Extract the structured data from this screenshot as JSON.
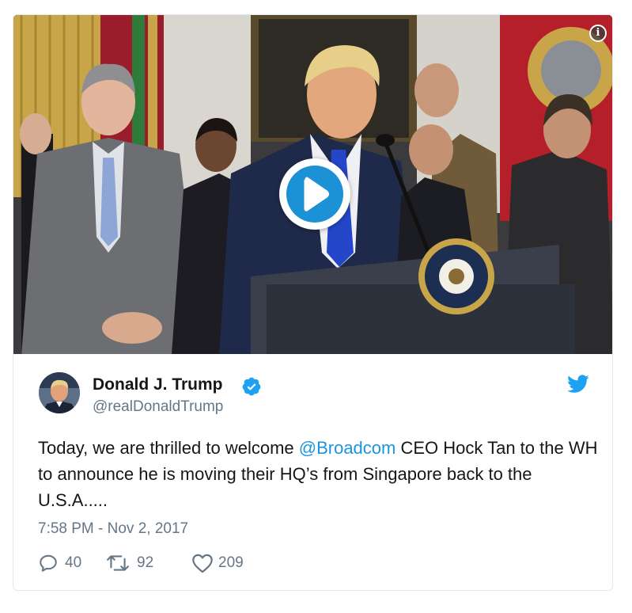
{
  "tweet": {
    "author_name": "Donald J. Trump",
    "author_handle": "@realDonaldTrump",
    "text_before_mention": "Today, we are thrilled to welcome ",
    "mention": "@Broadcom",
    "text_after_mention": " CEO Hock Tan to the WH to announce he is moving their HQ’s from Singapore back to the U.S.A.....",
    "timestamp": "7:58 PM - Nov 2, 2017",
    "replies": "40",
    "retweets": "92",
    "likes": "209"
  },
  "media": {
    "type": "video",
    "info_icon_label": "i"
  },
  "colors": {
    "link": "#1b95e0",
    "play_button": "#1d91d6",
    "verified": "#1da1f2",
    "secondary_text": "#657786",
    "border": "#e1e8ed"
  },
  "icons": {
    "play": "play-icon",
    "info": "info-icon",
    "verified": "verified-badge-icon",
    "twitter": "twitter-bird-icon",
    "reply": "reply-icon",
    "retweet": "retweet-icon",
    "like": "heart-icon"
  }
}
